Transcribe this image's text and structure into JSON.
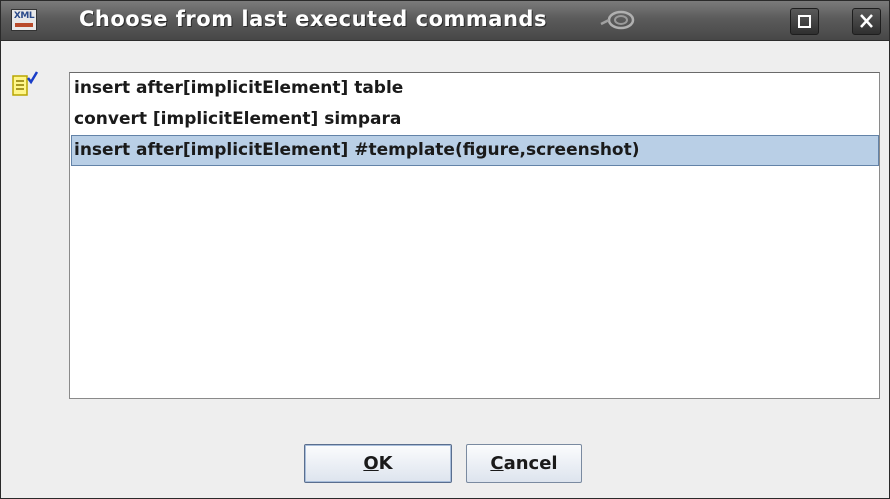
{
  "window": {
    "title": "Choose from last executed commands",
    "app_icon_text": "XML"
  },
  "commands": {
    "items": [
      "insert after[implicitElement] table",
      "convert [implicitElement] simpara",
      "insert after[implicitElement] #template(figure,screenshot)"
    ],
    "selected_index": 2
  },
  "buttons": {
    "ok_mnemonic": "O",
    "ok_rest": "K",
    "cancel_mnemonic": "C",
    "cancel_rest": "ancel"
  },
  "colors": {
    "selection": "#b9cfe6",
    "selection_border": "#6383a8",
    "titlebar": "#5b5b5b"
  }
}
